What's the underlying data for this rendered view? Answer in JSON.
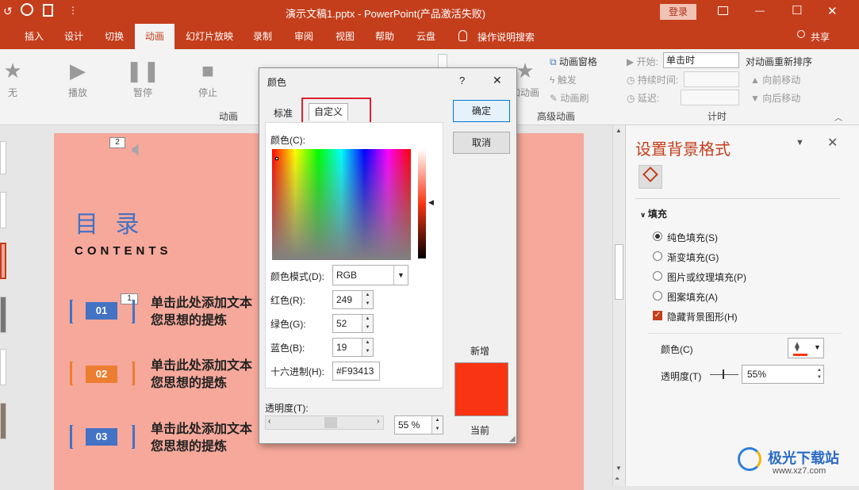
{
  "titlebar": {
    "title": "演示文稿1.pptx  -  PowerPoint(产品激活失败)",
    "login_label": "登录",
    "minimize_glyph": "—",
    "restore_glyph": "☐",
    "close_glyph": "✕",
    "qa_dropdown_glyph": "⋮"
  },
  "tabs": [
    "插入",
    "设计",
    "切换",
    "动画",
    "幻灯片放映",
    "录制",
    "审阅",
    "视图",
    "帮助",
    "云盘"
  ],
  "active_tab": "动画",
  "search_label": "操作说明搜索",
  "share_label": "共享",
  "ribbon": {
    "anim_buttons": [
      "无",
      "播放",
      "暂停",
      "停止"
    ],
    "group_anim": "动画",
    "add_anim": "加动画",
    "anim_pane": "动画窗格",
    "trigger": "触发",
    "anim_painter": "动画刷",
    "group_adv": "高级动画",
    "start_label": "开始:",
    "start_value": "单击时",
    "duration_label": "持续时间:",
    "delay_label": "延迟:",
    "reorder_label": "对动画重新排序",
    "move_earlier": "向前移动",
    "move_later": "向后移动",
    "group_timing": "计时"
  },
  "slide": {
    "sound_tag": "2",
    "title": "目 录",
    "subtitle": "CONTENTS",
    "items": [
      {
        "num": "01",
        "text1": "单击此处添加文本",
        "text2": "您思想的提炼",
        "tag": "1",
        "color": "#4472c4"
      },
      {
        "num": "02",
        "text1": "单击此处添加文本",
        "text2": "您思想的提炼",
        "tag": "",
        "color": "#ed7d31"
      },
      {
        "num": "03",
        "text1": "单击此处添加文本",
        "text2": "您思想的提炼",
        "tag": "",
        "color": "#4472c4"
      }
    ]
  },
  "pane": {
    "title": "设置背景格式",
    "section": "填充",
    "options": [
      "纯色填充(S)",
      "渐变填充(G)",
      "图片或纹理填充(P)",
      "图案填充(A)"
    ],
    "selected_option": 0,
    "hide_bg": "隐藏背景图形(H)",
    "color_label": "颜色(C)",
    "transparency_label": "透明度(T)",
    "transparency_value": "55%",
    "transparency_fraction": 0.55
  },
  "dialog": {
    "title": "颜色",
    "help": "?",
    "close": "✕",
    "tab_standard": "标准",
    "tab_custom": "自定义",
    "colors_label": "颜色(C):",
    "ok": "确定",
    "cancel": "取消",
    "model_label": "颜色模式(D):",
    "model_value": "RGB",
    "red_label": "红色(R):",
    "red_value": "249",
    "green_label": "绿色(G):",
    "green_value": "52",
    "blue_label": "蓝色(B):",
    "blue_value": "19",
    "hex_label": "十六进制(H):",
    "hex_value": "#F93413",
    "new_label": "新增",
    "current_label": "当前",
    "transparency_label": "透明度(T):",
    "transparency_value": "55 %",
    "swatch_color": "#f93413"
  },
  "colors": {
    "brand": "#c43e1c",
    "highlight_box": "#e0202a",
    "slide_bg": "#f6a89a"
  },
  "watermark": {
    "text_cn": "极光下载站",
    "url": "www.xz7.com"
  }
}
